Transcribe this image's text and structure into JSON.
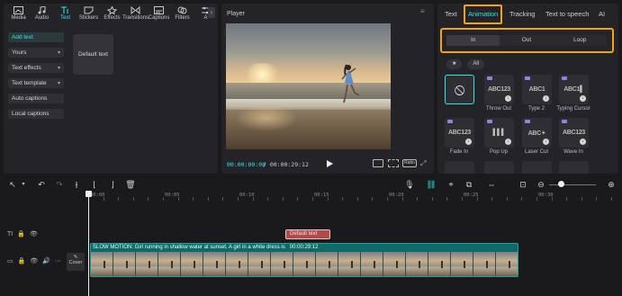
{
  "left_panel": {
    "tabs": [
      {
        "label": "Media",
        "icon": "media-icon",
        "active": false
      },
      {
        "label": "Audio",
        "icon": "audio-icon",
        "active": false
      },
      {
        "label": "Text",
        "icon": "text-icon",
        "active": true
      },
      {
        "label": "Stickers",
        "icon": "stickers-icon",
        "active": false
      },
      {
        "label": "Effects",
        "icon": "effects-icon",
        "active": false
      },
      {
        "label": "Transitions",
        "icon": "transitions-icon",
        "active": false
      },
      {
        "label": "Captions",
        "icon": "captions-icon",
        "active": false
      },
      {
        "label": "Filters",
        "icon": "filters-icon",
        "active": false
      },
      {
        "label": "A",
        "icon": "adjustment-icon",
        "active": false
      }
    ],
    "scroll_glyph": "›",
    "side_items": [
      {
        "label": "Add text",
        "active": true,
        "chevron": false
      },
      {
        "label": "Yours",
        "active": false,
        "chevron": true
      },
      {
        "label": "Text effects",
        "active": false,
        "chevron": true
      },
      {
        "label": "Text template",
        "active": false,
        "chevron": true
      },
      {
        "label": "Auto captions",
        "active": false,
        "chevron": false
      },
      {
        "label": "Local captions",
        "active": false,
        "chevron": false
      }
    ],
    "default_text_card": "Default text"
  },
  "player": {
    "title": "Player",
    "current_time": "00:00:00:00",
    "total_time": "00:00:29:12",
    "ratio_label": "Ratio"
  },
  "right_panel": {
    "tabs": [
      "Text",
      "Animation",
      "Tracking",
      "Text to speech",
      "AI"
    ],
    "active_tab": "Animation",
    "segments": [
      "In",
      "Out",
      "Loop"
    ],
    "active_segment": "In",
    "filter_chips": [
      "★",
      "All"
    ],
    "presets_row1": [
      {
        "label": "",
        "thumb": "⦸",
        "selected": true
      },
      {
        "label": "Throw Out",
        "thumb": "ABC123"
      },
      {
        "label": "Type 2",
        "thumb": "ABC1"
      },
      {
        "label": "Typing Cursor",
        "thumb": "ABC1▌"
      }
    ],
    "presets_row2": [
      {
        "label": "Fade In",
        "thumb": "ABC123"
      },
      {
        "label": "Pop Up",
        "thumb": "▌▌▌"
      },
      {
        "label": "Laser Cut",
        "thumb": "ABC✦"
      },
      {
        "label": "Wave In",
        "thumb": "ABC123"
      }
    ]
  },
  "timeline": {
    "ruler_labels": [
      "00:00",
      "00:05",
      "00:10",
      "00:15",
      "00:20",
      "00:25",
      "00:30"
    ],
    "text_clip": "Default text",
    "video_caption": "SLOW MOTION: Girl running in shallow water at sunset. A girl in a white dress is",
    "video_duration": "00:00:29:12",
    "cover_label": "Cover",
    "frame_count": 19
  },
  "colors": {
    "accent": "#2ee6e6",
    "highlight_box": "#f0a31a",
    "text_clip": "#b14a4a",
    "video_clip": "#0f6a67"
  }
}
